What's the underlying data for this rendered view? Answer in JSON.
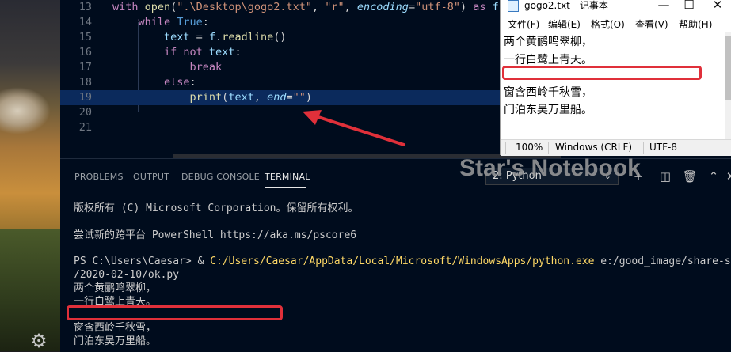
{
  "editor": {
    "lines": [
      {
        "num": "13",
        "tokens": [
          {
            "t": "with ",
            "c": "kw"
          },
          {
            "t": "open",
            "c": "fn"
          },
          {
            "t": "(",
            "c": ""
          },
          {
            "t": "\".\\Desktop\\gogo2.txt\"",
            "c": "str"
          },
          {
            "t": ", ",
            "c": ""
          },
          {
            "t": "\"r\"",
            "c": "str"
          },
          {
            "t": ", ",
            "c": ""
          },
          {
            "t": "encoding",
            "c": "param"
          },
          {
            "t": "=",
            "c": ""
          },
          {
            "t": "\"utf-8\"",
            "c": "str"
          },
          {
            "t": ") ",
            "c": ""
          },
          {
            "t": "as ",
            "c": "kw"
          },
          {
            "t": "f:",
            "c": "var"
          }
        ]
      },
      {
        "num": "14",
        "tokens": [
          {
            "t": "    while ",
            "c": "kw"
          },
          {
            "t": "True",
            "c": "kw2"
          },
          {
            "t": ":",
            "c": ""
          }
        ]
      },
      {
        "num": "15",
        "tokens": [
          {
            "t": "        text",
            "c": "var"
          },
          {
            "t": " = ",
            "c": ""
          },
          {
            "t": "f",
            "c": "var"
          },
          {
            "t": ".",
            "c": ""
          },
          {
            "t": "readline",
            "c": "fn"
          },
          {
            "t": "()",
            "c": ""
          }
        ]
      },
      {
        "num": "16",
        "tokens": [
          {
            "t": "        if not ",
            "c": "kw"
          },
          {
            "t": "text",
            "c": "var"
          },
          {
            "t": ":",
            "c": ""
          }
        ]
      },
      {
        "num": "17",
        "tokens": [
          {
            "t": "            break",
            "c": "kw"
          }
        ]
      },
      {
        "num": "18",
        "tokens": [
          {
            "t": "        else",
            "c": "kw"
          },
          {
            "t": ":",
            "c": ""
          }
        ]
      },
      {
        "num": "19",
        "tokens": [
          {
            "t": "            print",
            "c": "fn"
          },
          {
            "t": "(",
            "c": ""
          },
          {
            "t": "text",
            "c": "var"
          },
          {
            "t": ", ",
            "c": ""
          },
          {
            "t": "end",
            "c": "param"
          },
          {
            "t": "=",
            "c": ""
          },
          {
            "t": "\"\"",
            "c": "str"
          },
          {
            "t": ")",
            "c": ""
          }
        ]
      },
      {
        "num": "20",
        "tokens": []
      },
      {
        "num": "21",
        "tokens": []
      }
    ]
  },
  "notepad": {
    "title": "gogo2.txt - 记事本",
    "menu": [
      "文件(F)",
      "编辑(E)",
      "格式(O)",
      "查看(V)",
      "帮助(H)"
    ],
    "lines": [
      "两个黄鹂鸣翠柳，",
      "一行白鹭上青天。",
      "",
      "窗含西岭千秋雪，",
      "门泊东吴万里船。"
    ],
    "status": {
      "zoom": "100%",
      "eol": "Windows (CRLF)",
      "encoding": "UTF-8"
    }
  },
  "panel": {
    "tabs": [
      "PROBLEMS",
      "OUTPUT",
      "DEBUG CONSOLE",
      "TERMINAL"
    ],
    "active_tab": "TERMINAL",
    "terminal_select": "2: Python",
    "terminal_lines": [
      "版权所有 (C) Microsoft Corporation。保留所有权利。",
      "",
      "尝试新的跨平台 PowerShell https://aka.ms/pscore6",
      "",
      "PS C:\\Users\\Caesar> & ",
      "/2020-02-10/ok.py",
      "两个黄鹂鸣翠柳，",
      "一行白鹭上青天。",
      "",
      "窗含西岭千秋雪，",
      "门泊东吴万里船。"
    ],
    "python_path": "C:/Users/Caesar/AppData/Local/Microsoft/WindowsApps/python.exe",
    "script_arg": " e:/good_image/share-scan"
  },
  "watermark": "Star's Notebook",
  "colors": {
    "annotation_red": "#e0303a",
    "editor_bg": "#000c1d",
    "current_line": "#0b2a5c"
  }
}
